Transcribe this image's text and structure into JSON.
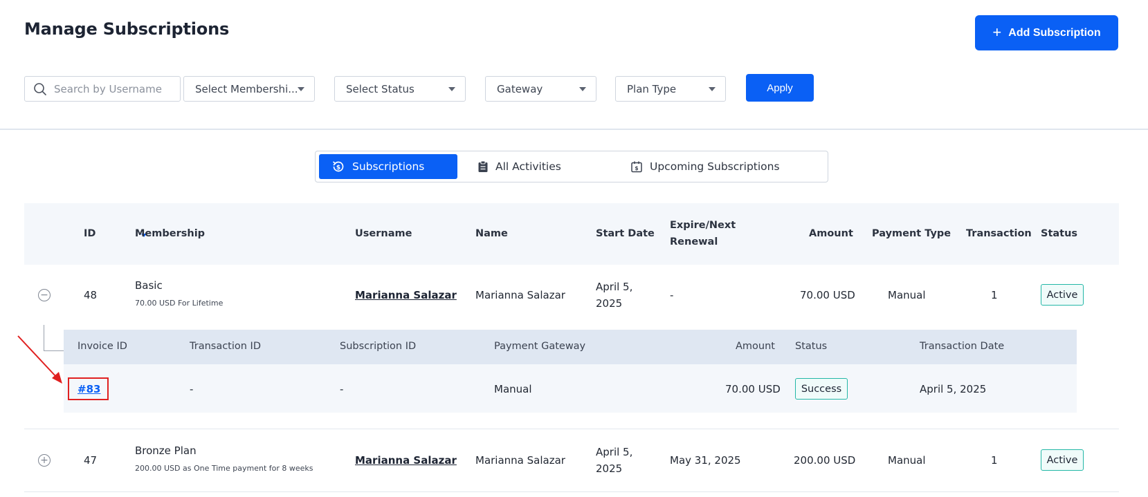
{
  "header": {
    "title": "Manage Subscriptions",
    "add_label": "Add Subscription"
  },
  "filters": {
    "search_placeholder": "Search by Username",
    "membership": "Select Membershi...",
    "status": "Select Status",
    "gateway": "Gateway",
    "plan_type": "Plan Type",
    "apply_label": "Apply"
  },
  "tabs": [
    {
      "label": "Subscriptions",
      "active": true
    },
    {
      "label": "All Activities",
      "active": false
    },
    {
      "label": "Upcoming Subscriptions",
      "active": false
    }
  ],
  "columns": {
    "id": "ID",
    "membership": "Membership",
    "username": "Username",
    "name": "Name",
    "start_date": "Start Date",
    "expire_1": "Expire/Next",
    "expire_2": "Renewal",
    "amount": "Amount",
    "payment_type": "Payment Type",
    "transaction": "Transaction",
    "status": "Status"
  },
  "rows": [
    {
      "id": "48",
      "membership": "Basic",
      "membership_desc": "70.00 USD For Lifetime",
      "username": "Marianna Salazar",
      "name": "Marianna Salazar",
      "start_1": "April 5,",
      "start_2": "2025",
      "expire": "-",
      "amount": "70.00 USD",
      "payment_type": "Manual",
      "transaction": "1",
      "status": "Active"
    },
    {
      "id": "47",
      "membership": "Bronze Plan",
      "membership_desc": "200.00 USD as One Time payment for 8 weeks",
      "username": "Marianna Salazar",
      "name": "Marianna Salazar",
      "start_1": "April 5,",
      "start_2": "2025",
      "expire": "May 31, 2025",
      "amount": "200.00 USD",
      "payment_type": "Manual",
      "transaction": "1",
      "status": "Active"
    }
  ],
  "invoice_columns": {
    "invoice_id": "Invoice ID",
    "transaction_id": "Transaction ID",
    "subscription_id": "Subscription ID",
    "gateway": "Payment Gateway",
    "amount": "Amount",
    "status": "Status",
    "date": "Transaction Date"
  },
  "invoice": {
    "invoice_id": "#83",
    "transaction_id": "-",
    "subscription_id": "-",
    "gateway": "Manual",
    "amount": "70.00 USD",
    "status": "Success",
    "date": "April 5, 2025"
  },
  "colors": {
    "primary": "#0a60f5",
    "badge_border": "#22b7a6",
    "annotation": "#e02020"
  }
}
